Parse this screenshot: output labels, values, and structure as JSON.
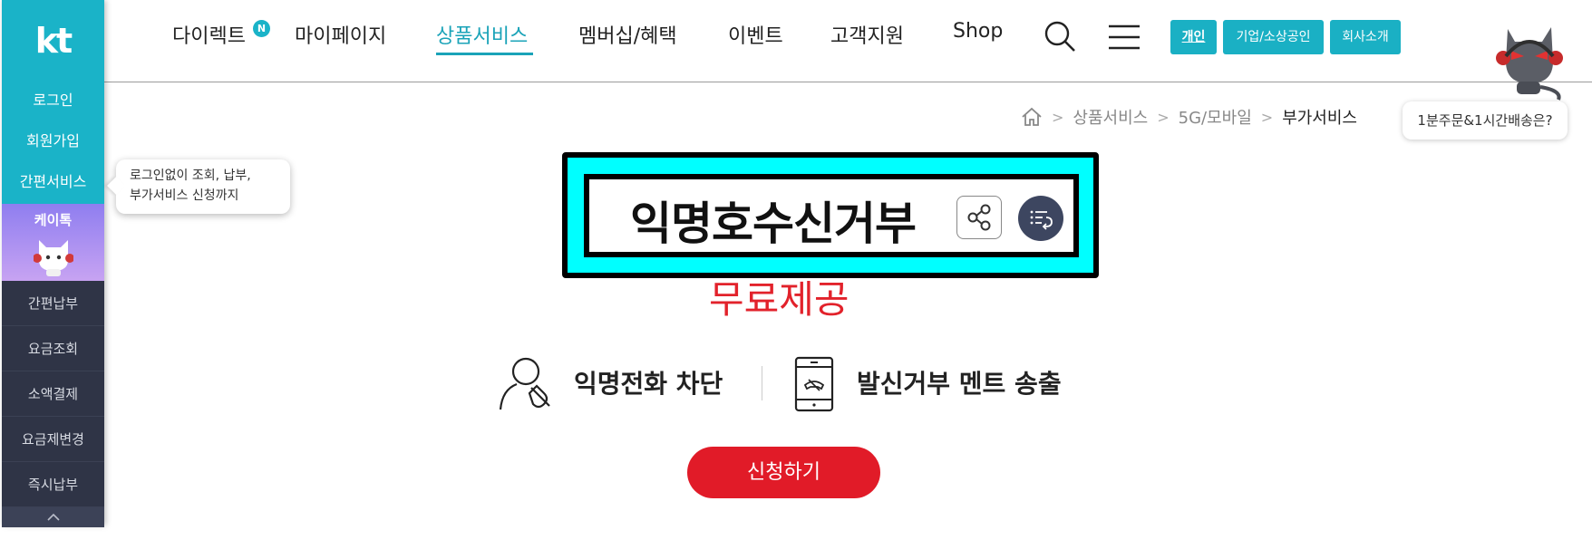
{
  "sidebar": {
    "logo": "kt",
    "top_items": [
      {
        "label": "로그인"
      },
      {
        "label": "회원가입"
      },
      {
        "label": "간편서비스"
      }
    ],
    "katalk_label": "케이톡",
    "dark_items": [
      {
        "label": "간편납부"
      },
      {
        "label": "요금조회"
      },
      {
        "label": "소액결제"
      },
      {
        "label": "요금제변경"
      },
      {
        "label": "즉시납부"
      }
    ],
    "tooltip_line1": "로그인없이 조회, 납부,",
    "tooltip_line2": "부가서비스 신청까지"
  },
  "header": {
    "nav": [
      {
        "label": "다이렉트"
      },
      {
        "label": "마이페이지"
      },
      {
        "label": "상품서비스",
        "active": true
      },
      {
        "label": "멤버십/혜택"
      },
      {
        "label": "이벤트"
      },
      {
        "label": "고객지원"
      },
      {
        "label": "Shop"
      }
    ],
    "new_badge": "N",
    "segments": [
      {
        "label": "개인",
        "active": true
      },
      {
        "label": "기업/소상공인"
      },
      {
        "label": "회사소개"
      }
    ],
    "icons": [
      "search-icon",
      "menu-icon"
    ]
  },
  "promo": {
    "bubble": "1분주문&1시간배송은?"
  },
  "breadcrumb": {
    "items": [
      "상품서비스",
      "5G/모바일"
    ],
    "current": "부가서비스"
  },
  "page": {
    "title": "익명호수신거부",
    "subtitle": "무료제공",
    "features": [
      {
        "label": "익명전화 차단",
        "icon": "phone-block-icon"
      },
      {
        "label": "발신거부 멘트 송출",
        "icon": "mobile-phone-icon"
      }
    ],
    "apply_button": "신청하기"
  },
  "colors": {
    "brand": "#1ab3c8",
    "sidebar_dark": "#2f3446",
    "accent_red": "#e11b28",
    "highlight": "#00ffff"
  }
}
